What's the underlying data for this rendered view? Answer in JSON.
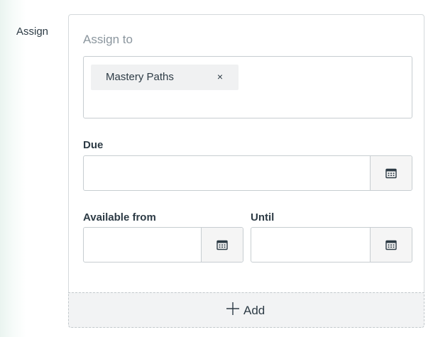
{
  "assign": {
    "label": "Assign"
  },
  "assign_to": {
    "label": "Assign to",
    "tokens": [
      {
        "label": "Mastery Paths",
        "remove_symbol": "×"
      }
    ]
  },
  "due": {
    "label": "Due",
    "value": "",
    "icon": "calendar-icon"
  },
  "available_from": {
    "label": "Available from",
    "value": "",
    "icon": "calendar-icon"
  },
  "until": {
    "label": "Until",
    "value": "",
    "icon": "calendar-icon"
  },
  "add": {
    "label": "Add",
    "icon": "plus-icon"
  },
  "colors": {
    "text": "#2d3b45",
    "muted": "#8b969e",
    "border": "#c7cdd1",
    "token_bg": "#f0f1f2",
    "add_bar_bg": "#f2f3f4"
  }
}
